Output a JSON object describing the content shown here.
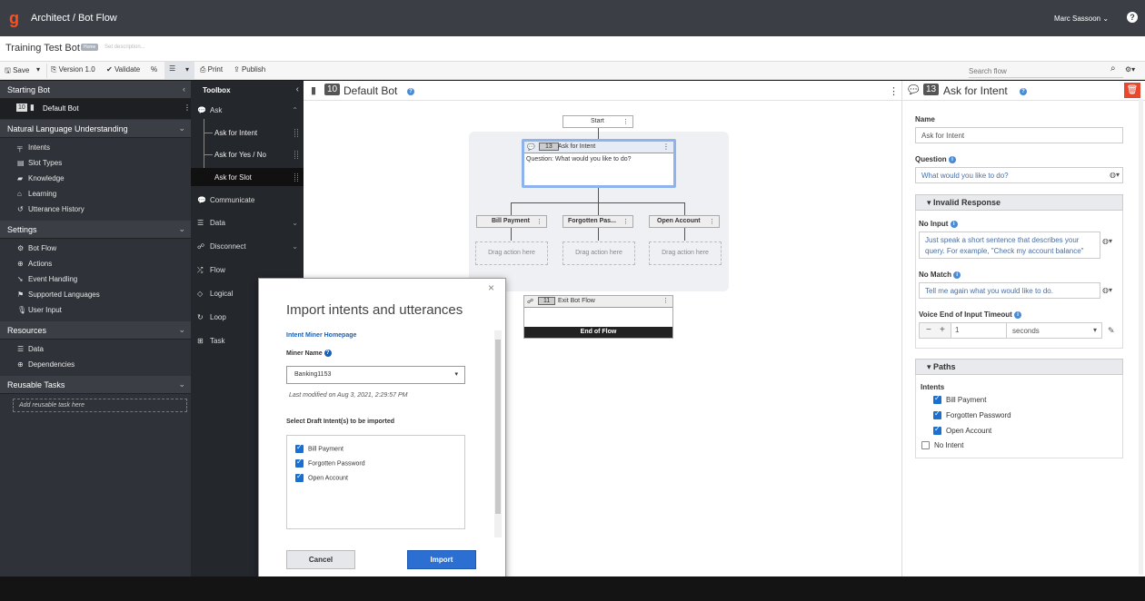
{
  "topbar": {
    "logo": "g",
    "breadcrumb": "Architect  /  Bot Flow",
    "user": "Marc Sassoon",
    "user_chevron": "⌄",
    "help": "?"
  },
  "titlebar": {
    "title": "Training Test Bot",
    "badge": "Home",
    "description_placeholder": "Set description..."
  },
  "toolbar": {
    "save": "Save",
    "version": "Version 1.0",
    "validate": "Validate",
    "print": "Print",
    "publish": "Publish",
    "search_placeholder": "Search flow"
  },
  "leftnav": {
    "starting_bot_header": "Starting Bot",
    "default_bot_num": "10",
    "default_bot": "Default Bot",
    "nlu_header": "Natural Language Understanding",
    "nlu_items": [
      "Intents",
      "Slot Types",
      "Knowledge",
      "Learning",
      "Utterance History"
    ],
    "settings_header": "Settings",
    "settings_items": [
      "Bot Flow",
      "Actions",
      "Event Handling",
      "Supported Languages",
      "User Input"
    ],
    "resources_header": "Resources",
    "resources_items": [
      "Data",
      "Dependencies"
    ],
    "reusable_header": "Reusable Tasks",
    "add_reusable": "Add reusable task here"
  },
  "toolbox": {
    "header": "Toolbox",
    "ask": "Ask",
    "ask_items": [
      "Ask for Intent",
      "Ask for Yes / No",
      "Ask for Slot"
    ],
    "categories": [
      "Communicate",
      "Data",
      "Disconnect",
      "Flow",
      "Logical",
      "Loop",
      "Task"
    ]
  },
  "canvas": {
    "num": "10",
    "title": "Default Bot",
    "start": "Start",
    "ask_intent_num": "13",
    "ask_intent": "Ask for Intent",
    "question": "Question: What would you like to do?",
    "paths": [
      "Bill Payment",
      "Forgotten Pas...",
      "Open Account"
    ],
    "drag_here": "Drag action here",
    "exit_num": "11",
    "exit": "Exit Bot Flow",
    "end": "End of Flow"
  },
  "right": {
    "num": "13",
    "title": "Ask for Intent",
    "name_label": "Name",
    "name_value": "Ask for Intent",
    "question_label": "Question",
    "question_value": "What would you like to do?",
    "invalid_response": "Invalid Response",
    "no_input_label": "No Input",
    "no_input_value": "Just speak a short sentence that describes your query. For example, \"Check my account balance\"",
    "no_match_label": "No Match",
    "no_match_value": "Tell me again what you would like to do.",
    "timeout_label": "Voice End of Input Timeout",
    "timeout_minus": "−",
    "timeout_plus": "+",
    "timeout_value": "1",
    "timeout_unit": "seconds",
    "paths_header": "Paths",
    "intents_label": "Intents",
    "intents": [
      "Bill Payment",
      "Forgotten Password",
      "Open Account"
    ],
    "no_intent": "No Intent"
  },
  "dialog": {
    "title": "Import intents and utterances",
    "homepage_link": "Intent Miner Homepage",
    "miner_label": "Miner Name",
    "miner_value": "Banking1153",
    "modified": "Last modified on Aug 3, 2021, 2:29:57 PM",
    "select_label": "Select Draft Intent(s) to be imported",
    "intents": [
      "Bill Payment",
      "Forgotten Password",
      "Open Account"
    ],
    "cancel": "Cancel",
    "import": "Import",
    "close": "×"
  }
}
